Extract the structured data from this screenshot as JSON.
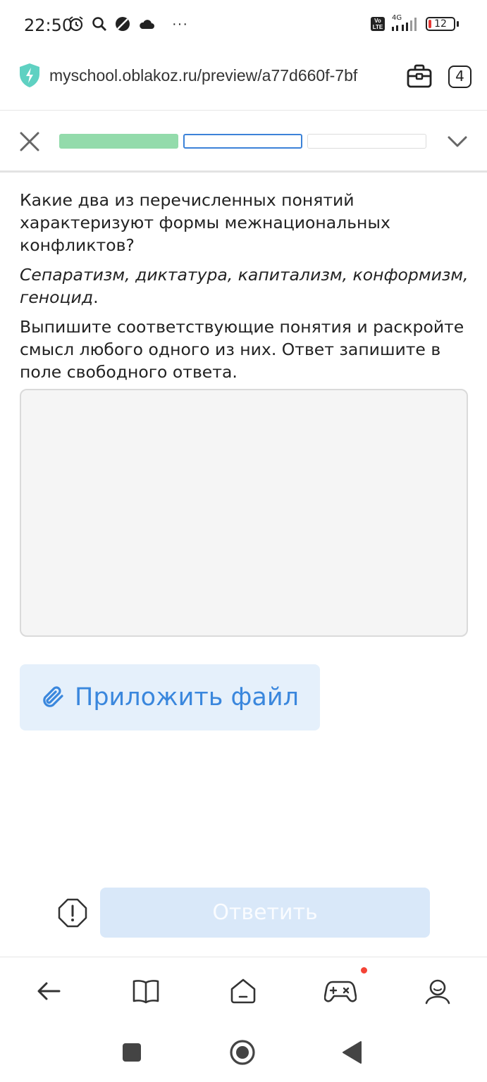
{
  "status_bar": {
    "time": "22:50",
    "network_badge_top": "Vo",
    "network_badge_bottom": "LTE",
    "network_type": "4G",
    "battery_level": "12",
    "overflow": "···"
  },
  "browser": {
    "url": "myschool.oblakoz.ru/preview/a77d660f-7bf",
    "tab_count": "4"
  },
  "quiz": {
    "progress": [
      {
        "state": "done"
      },
      {
        "state": "current"
      },
      {
        "state": "todo"
      }
    ],
    "question_line": "Какие два из перечисленных понятий характеризуют формы межнациональных конфликтов?",
    "terms": "Сепаратизм, диктатура, капитализм, конформизм, геноцид",
    "terms_end": ".",
    "instruction": "Выпишите соответствующие понятия и раскройте смысл любого одного из них. Ответ запишите в поле свободного ответа.",
    "answer_value": "",
    "attach_label": "Приложить файл",
    "submit_label": "Ответить"
  },
  "colors": {
    "progress_done": "#93dbab",
    "progress_current": "#3c82d8",
    "accent": "#3a87dd",
    "submit_bg": "#d9e8f9",
    "notification": "#f44336"
  }
}
